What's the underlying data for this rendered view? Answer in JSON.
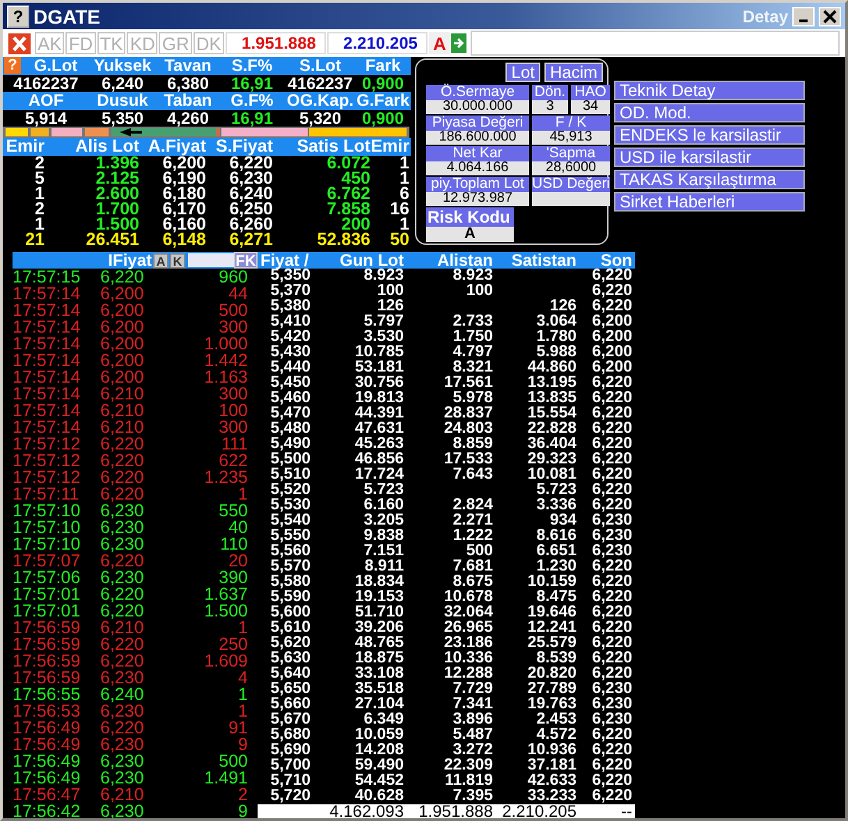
{
  "window": {
    "help": "?",
    "title": "DGATE",
    "subtitle": "Detay"
  },
  "summary_help": "?",
  "toolbar": {
    "tabs": [
      "AK",
      "FD",
      "TK",
      "KD",
      "GR",
      "DK"
    ],
    "buy_total": "1.951.888",
    "sell_total": "2.210.205",
    "mode": "A"
  },
  "summary": [
    {
      "cells": [
        {
          "label": "G.Lot",
          "value": "4162237",
          "kind": "plain"
        },
        {
          "label": "Yuksek",
          "value": "6,240",
          "kind": "plain"
        },
        {
          "label": "Tavan",
          "value": "6,380",
          "kind": "plain"
        },
        {
          "label": "S.F%",
          "value": "16,91",
          "kind": "change"
        },
        {
          "label": "S.Lot",
          "value": "4162237",
          "kind": "plain"
        },
        {
          "label": "Fark",
          "value": "0,900",
          "kind": "change"
        }
      ]
    },
    {
      "cells": [
        {
          "label": "AOF",
          "value": "5,914",
          "kind": "plain"
        },
        {
          "label": "Dusuk",
          "value": "5,350",
          "kind": "plain"
        },
        {
          "label": "Taban",
          "value": "4,260",
          "kind": "plain"
        },
        {
          "label": "G.F%",
          "value": "16,91",
          "kind": "change"
        },
        {
          "label": "OG.Kap.",
          "value": "5,320",
          "kind": "plain"
        },
        {
          "label": "G.Fark",
          "value": "0,900",
          "kind": "change"
        }
      ]
    }
  ],
  "depth": {
    "columns": [
      "Emir",
      "Alis Lot",
      "A.Fiyat",
      "S.Fiyat",
      "Satis Lot",
      "Emir"
    ],
    "rows": [
      [
        "2",
        "1.396",
        "6,200",
        "6,220",
        "6.072",
        "1"
      ],
      [
        "5",
        "2.125",
        "6,190",
        "6,230",
        "450",
        "1"
      ],
      [
        "1",
        "2.600",
        "6,180",
        "6,240",
        "6.762",
        "6"
      ],
      [
        "2",
        "1.700",
        "6,170",
        "6,250",
        "7.858",
        "16"
      ],
      [
        "1",
        "1.500",
        "6,160",
        "6,260",
        "200",
        "1"
      ]
    ],
    "totals": [
      "21",
      "26.451",
      "6,148",
      "6,271",
      "52.836",
      "50"
    ]
  },
  "trades": {
    "header": "IFiyat",
    "buttons": [
      "A",
      "K"
    ],
    "filter_button": "FK",
    "rows": [
      {
        "time": "17:57:15",
        "price": "6,220",
        "lot": "960",
        "color": "#22ee22"
      },
      {
        "time": "17:57:14",
        "price": "6,200",
        "lot": "44",
        "color": "#dd2020"
      },
      {
        "time": "17:57:14",
        "price": "6,200",
        "lot": "500",
        "color": "#dd2020"
      },
      {
        "time": "17:57:14",
        "price": "6,200",
        "lot": "300",
        "color": "#dd2020"
      },
      {
        "time": "17:57:14",
        "price": "6,200",
        "lot": "1.000",
        "color": "#dd2020"
      },
      {
        "time": "17:57:14",
        "price": "6,200",
        "lot": "1.442",
        "color": "#dd2020"
      },
      {
        "time": "17:57:14",
        "price": "6,200",
        "lot": "1.163",
        "color": "#dd2020"
      },
      {
        "time": "17:57:14",
        "price": "6,210",
        "lot": "300",
        "color": "#dd2020"
      },
      {
        "time": "17:57:14",
        "price": "6,210",
        "lot": "100",
        "color": "#dd2020"
      },
      {
        "time": "17:57:14",
        "price": "6,210",
        "lot": "300",
        "color": "#dd2020"
      },
      {
        "time": "17:57:12",
        "price": "6,220",
        "lot": "111",
        "color": "#dd2020"
      },
      {
        "time": "17:57:12",
        "price": "6,220",
        "lot": "622",
        "color": "#dd2020"
      },
      {
        "time": "17:57:12",
        "price": "6,220",
        "lot": "1.235",
        "color": "#dd2020"
      },
      {
        "time": "17:57:11",
        "price": "6,220",
        "lot": "1",
        "color": "#dd2020"
      },
      {
        "time": "17:57:10",
        "price": "6,230",
        "lot": "550",
        "color": "#22ee22"
      },
      {
        "time": "17:57:10",
        "price": "6,230",
        "lot": "40",
        "color": "#22ee22"
      },
      {
        "time": "17:57:10",
        "price": "6,230",
        "lot": "110",
        "color": "#22ee22"
      },
      {
        "time": "17:57:07",
        "price": "6,220",
        "lot": "20",
        "color": "#dd2020"
      },
      {
        "time": "17:57:06",
        "price": "6,230",
        "lot": "390",
        "color": "#22ee22"
      },
      {
        "time": "17:57:01",
        "price": "6,220",
        "lot": "1.637",
        "color": "#22ee22"
      },
      {
        "time": "17:57:01",
        "price": "6,220",
        "lot": "1.500",
        "color": "#22ee22"
      },
      {
        "time": "17:56:59",
        "price": "6,210",
        "lot": "1",
        "color": "#dd2020"
      },
      {
        "time": "17:56:59",
        "price": "6,220",
        "lot": "250",
        "color": "#dd2020"
      },
      {
        "time": "17:56:59",
        "price": "6,220",
        "lot": "1.609",
        "color": "#dd2020"
      },
      {
        "time": "17:56:59",
        "price": "6,230",
        "lot": "4",
        "color": "#dd2020"
      },
      {
        "time": "17:56:55",
        "price": "6,240",
        "lot": "1",
        "color": "#22ee22"
      },
      {
        "time": "17:56:53",
        "price": "6,230",
        "lot": "1",
        "color": "#dd2020"
      },
      {
        "time": "17:56:49",
        "price": "6,220",
        "lot": "91",
        "color": "#dd2020"
      },
      {
        "time": "17:56:49",
        "price": "6,230",
        "lot": "9",
        "color": "#dd2020"
      },
      {
        "time": "17:56:49",
        "price": "6,230",
        "lot": "500",
        "color": "#22ee22"
      },
      {
        "time": "17:56:49",
        "price": "6,230",
        "lot": "1.491",
        "color": "#22ee22"
      },
      {
        "time": "17:56:47",
        "price": "6,210",
        "lot": "2",
        "color": "#dd2020"
      },
      {
        "time": "17:56:42",
        "price": "6,230",
        "lot": "9",
        "color": "#22ee22"
      }
    ]
  },
  "price_table": {
    "columns": [
      "Fiyat /",
      "Gun Lot",
      "Alistan",
      "Satistan",
      "Son"
    ],
    "rows": [
      [
        "5,350",
        "8.923",
        "8.923",
        null,
        "6,220"
      ],
      [
        "5,370",
        "100",
        "100",
        null,
        "6,220"
      ],
      [
        "5,380",
        "126",
        null,
        "126",
        "6,220"
      ],
      [
        "5,410",
        "5.797",
        "2.733",
        "3.064",
        "6,200"
      ],
      [
        "5,420",
        "3.530",
        "1.750",
        "1.780",
        "6,200"
      ],
      [
        "5,430",
        "10.785",
        "4.797",
        "5.988",
        "6,200"
      ],
      [
        "5,440",
        "53.181",
        "8.321",
        "44.860",
        "6,200"
      ],
      [
        "5,450",
        "30.756",
        "17.561",
        "13.195",
        "6,220"
      ],
      [
        "5,460",
        "19.813",
        "5.978",
        "13.835",
        "6,220"
      ],
      [
        "5,470",
        "44.391",
        "28.837",
        "15.554",
        "6,220"
      ],
      [
        "5,480",
        "47.631",
        "24.803",
        "22.828",
        "6,220"
      ],
      [
        "5,490",
        "45.263",
        "8.859",
        "36.404",
        "6,220"
      ],
      [
        "5,500",
        "46.856",
        "17.533",
        "29.323",
        "6,220"
      ],
      [
        "5,510",
        "17.724",
        "7.643",
        "10.081",
        "6,220"
      ],
      [
        "5,520",
        "5.723",
        null,
        "5.723",
        "6,220"
      ],
      [
        "5,530",
        "6.160",
        "2.824",
        "3.336",
        "6,220"
      ],
      [
        "5,540",
        "3.205",
        "2.271",
        "934",
        "6,230"
      ],
      [
        "5,550",
        "9.838",
        "1.222",
        "8.616",
        "6,230"
      ],
      [
        "5,560",
        "7.151",
        "500",
        "6.651",
        "6,230"
      ],
      [
        "5,570",
        "8.911",
        "7.681",
        "1.230",
        "6,220"
      ],
      [
        "5,580",
        "18.834",
        "8.675",
        "10.159",
        "6,220"
      ],
      [
        "5,590",
        "19.153",
        "10.678",
        "8.475",
        "6,220"
      ],
      [
        "5,600",
        "51.710",
        "32.064",
        "19.646",
        "6,220"
      ],
      [
        "5,610",
        "39.206",
        "26.965",
        "12.241",
        "6,220"
      ],
      [
        "5,620",
        "48.765",
        "23.186",
        "25.579",
        "6,220"
      ],
      [
        "5,630",
        "18.875",
        "10.336",
        "8.539",
        "6,220"
      ],
      [
        "5,640",
        "33.108",
        "12.288",
        "20.820",
        "6,220"
      ],
      [
        "5,650",
        "35.518",
        "7.729",
        "27.789",
        "6,230"
      ],
      [
        "5,660",
        "27.104",
        "7.341",
        "19.763",
        "6,230"
      ],
      [
        "5,670",
        "6.349",
        "3.896",
        "2.453",
        "6,230"
      ],
      [
        "5,680",
        "10.059",
        "5.487",
        "4.572",
        "6,220"
      ],
      [
        "5,690",
        "14.208",
        "3.272",
        "10.936",
        "6,220"
      ],
      [
        "5,700",
        "59.490",
        "22.309",
        "37.181",
        "6,220"
      ],
      [
        "5,710",
        "54.452",
        "11.819",
        "42.633",
        "6,220"
      ],
      [
        "5,720",
        "40.628",
        "7.395",
        "33.233",
        "6,220"
      ]
    ],
    "totals": [
      "4.162.093",
      "1.951.888",
      "2.210.205",
      "--"
    ]
  },
  "details": {
    "toggles": [
      "Lot",
      "Hacim"
    ],
    "rows": [
      [
        {
          "label": "Ö.Sermaye",
          "value": "30.000.000"
        },
        {
          "label": "Dön.",
          "value": "3"
        },
        {
          "label": "HAO",
          "value": "34"
        }
      ],
      [
        {
          "label": "Piyasa Değeri",
          "value": "186.600.000"
        },
        {
          "label": "F / K",
          "value": "45,913"
        }
      ],
      [
        {
          "label": "Net Kar",
          "value": "4.064.166"
        },
        {
          "label": "'Sapma",
          "value": "28,6000"
        }
      ],
      [
        {
          "label": "piy.Toplam Lot",
          "value": "12.973.987"
        },
        {
          "label": "USD Değeri"
        }
      ]
    ],
    "risk": {
      "label": "Risk Kodu",
      "value": "A"
    }
  },
  "actions": [
    "Teknik Detay",
    "OD. Mod.",
    "ENDEKS le karsilastir",
    "USD ile karsilastir",
    "TAKAS Karşılaştırma",
    "Sirket Haberleri"
  ]
}
